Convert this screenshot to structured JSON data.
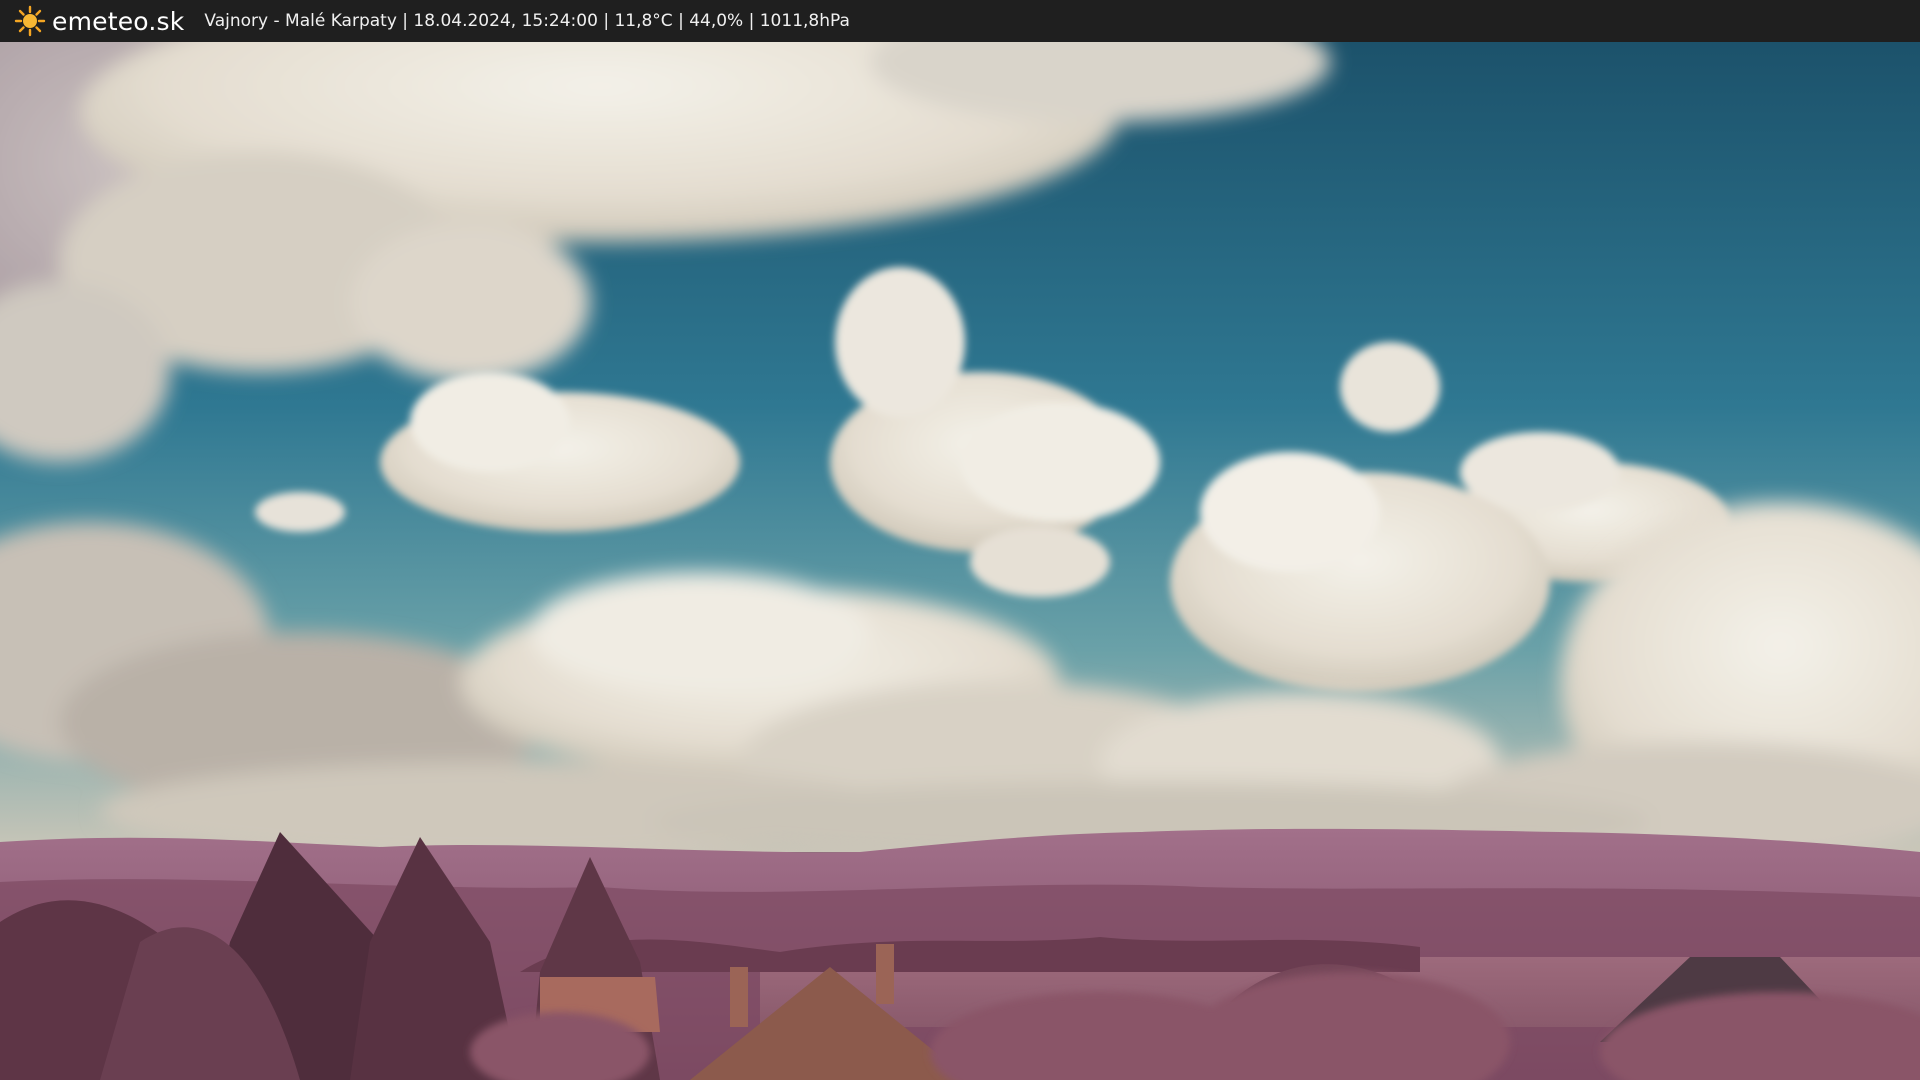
{
  "brand": {
    "name": "emeteo.sk",
    "icon": "sun-icon",
    "icon_color": "#f5a623"
  },
  "caption": {
    "text": "Vajnory - Malé Karpaty | 18.04.2024, 15:24:00 | 11,8°C | 44,0% | 1011,8hPa"
  },
  "scene": {
    "description_colors": {
      "sky_top": "#1f5a73",
      "sky_mid": "#3b86a0",
      "cloud": "#e9e4da",
      "hills": "#8e5a72",
      "foreground": "#6e4050"
    }
  }
}
